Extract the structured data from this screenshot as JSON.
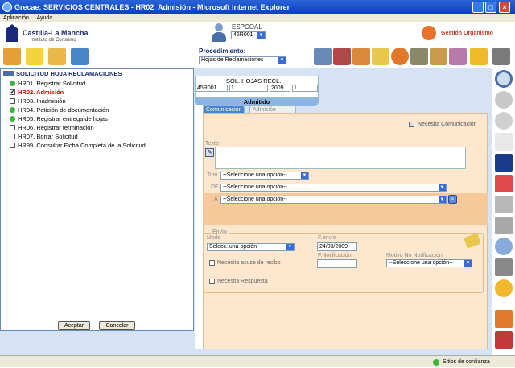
{
  "window": {
    "title": "Grecae: SERVICIOS CENTRALES - HR02. Admisión - Microsoft Internet Explorer"
  },
  "menu": [
    "Aplicación",
    "Ayuda"
  ],
  "header": {
    "logo": "Castilla-La Mancha",
    "logo_sub": "Instituto de Consumo",
    "user_code": "ESPCOAL",
    "office_select": "45R001",
    "org_label": "Gestión Organismo"
  },
  "procedure": {
    "label": "Procedimiento:",
    "value": "Hojas de Reclamaciones"
  },
  "tree": {
    "root": "SOLICITUD HOJA RECLAMACIONES",
    "items": [
      {
        "label": "HR01. Registrar Solicitud",
        "state": "done"
      },
      {
        "label": "HR02. Admisión",
        "state": "current"
      },
      {
        "label": "HR03. Inadmisión",
        "state": "unchecked"
      },
      {
        "label": "HR04. Petición de documentación",
        "state": "done"
      },
      {
        "label": "HR05. Registrar entrega de hojas",
        "state": "done"
      },
      {
        "label": "HR06. Registrar terminación",
        "state": "unchecked"
      },
      {
        "label": "HR07. Borrar Solicitud",
        "state": "unchecked"
      },
      {
        "label": "HR99. Consultar Ficha Completa de la Solicitud",
        "state": "unchecked"
      }
    ],
    "accept": "Aceptar",
    "cancel": "Cancelar"
  },
  "form_header": {
    "title": "SOL. HOJAS RECL.",
    "office": "45R001",
    "num": "1",
    "year": "2009",
    "seq": "1",
    "status": "Admitido"
  },
  "tabs": [
    "Comunicación",
    "Admisión"
  ],
  "form": {
    "needs_comm": "Necesita Comunicación",
    "texto_label": "Texto",
    "tipo_label": "Tipo",
    "tipo_value": "--Seleccione una opción--",
    "de_label": "DE",
    "de_value": "--Seleccione una opción--",
    "a_label": "A",
    "a_value": "--Seleccione una opción--",
    "envio_label": "Envío",
    "modo_label": "Modo",
    "modo_value": "Selecc. una opción",
    "fenvio_label": "F.envío",
    "fenvio_value": "24/03/2009",
    "acuse_label": "Necesita acuse de recibo",
    "fnotif_label": "F.Notificación",
    "motivo_label": "Motivo No Notificación",
    "motivo_value": "--Seleccione una opción--",
    "respuesta_label": "Necesita Respuesta"
  },
  "status": {
    "zone": "Sitios de confianza"
  },
  "colors": {
    "title_bar": "#0a3fb8",
    "panel": "#fde7cf",
    "main_bg": "#d6e3f5",
    "current_item": "#e00000"
  }
}
